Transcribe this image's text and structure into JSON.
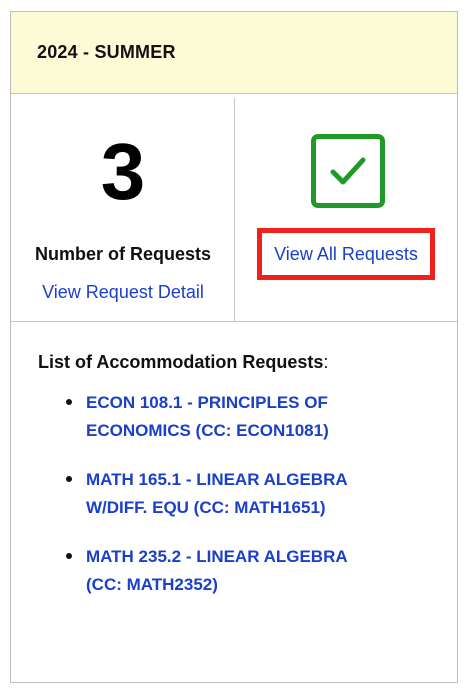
{
  "term": {
    "title": "2024 - SUMMER"
  },
  "summary": {
    "count": "3",
    "count_label": "Number of Requests",
    "detail_link": "View Request Detail",
    "status_icon": "check-icon",
    "view_all_link": "View All Requests"
  },
  "requests": {
    "heading": "List of Accommodation Requests",
    "heading_suffix": ":",
    "items": [
      {
        "label": "ECON 108.1 - PRINCIPLES OF ECONOMICS (CC: ECON1081)"
      },
      {
        "label": "MATH 165.1 - LINEAR ALGEBRA W/DIFF. EQU (CC: MATH1651)"
      },
      {
        "label": "MATH 235.2 - LINEAR ALGEBRA (CC: MATH2352)"
      }
    ]
  },
  "colors": {
    "header_bg": "#fdfbd6",
    "link": "#1a3fc9",
    "check": "#1f9a26",
    "highlight_border": "#f2201b"
  }
}
